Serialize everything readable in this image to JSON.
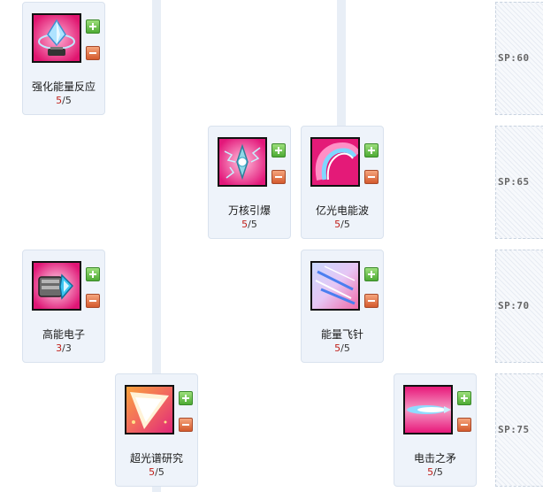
{
  "skills": [
    {
      "id": "qianghua",
      "name": "强化能量反应",
      "current": "5",
      "max": "5",
      "icon": "energy-crystal-icon"
    },
    {
      "id": "wanhe",
      "name": "万核引爆",
      "current": "5",
      "max": "5",
      "icon": "nuclear-detonation-icon"
    },
    {
      "id": "yiguang",
      "name": "亿光电能波",
      "current": "5",
      "max": "5",
      "icon": "electric-wave-icon"
    },
    {
      "id": "gaoneng",
      "name": "高能电子",
      "current": "3",
      "max": "3",
      "icon": "energy-gauntlet-icon"
    },
    {
      "id": "feizhen",
      "name": "能量飞针",
      "current": "5",
      "max": "5",
      "icon": "energy-needles-icon"
    },
    {
      "id": "chaoguang",
      "name": "超光谱研究",
      "current": "5",
      "max": "5",
      "icon": "light-beam-icon"
    },
    {
      "id": "dianji",
      "name": "电击之矛",
      "current": "5",
      "max": "5",
      "icon": "electric-spear-icon"
    }
  ],
  "sp_tiers": [
    "SP:60",
    "SP:65",
    "SP:70",
    "SP:75"
  ],
  "level_separator": "/",
  "colors": {
    "card_bg": "#eef3fa",
    "icon_bg": "#f0287f",
    "level_current": "#c0201a",
    "plus_button": "#4eaa34",
    "minus_button": "#d45a2d"
  }
}
